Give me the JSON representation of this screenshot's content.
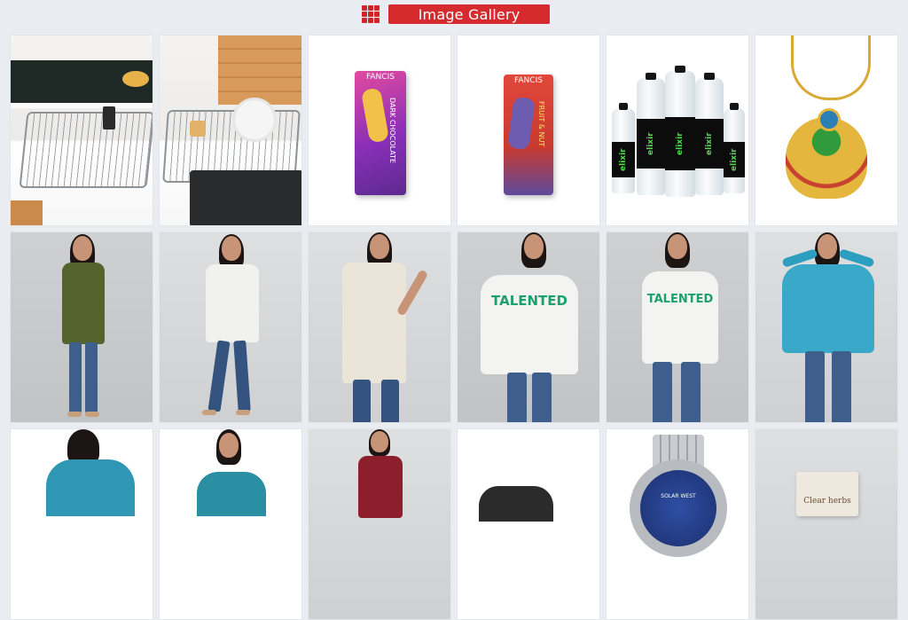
{
  "header": {
    "title": "Image Gallery",
    "icon": "grid-icon",
    "accent": "#d52b2f"
  },
  "gallery": {
    "items": [
      {
        "name": "dish-rack-kitchen-1"
      },
      {
        "name": "dish-rack-kitchen-2"
      },
      {
        "name": "chocolate-bar-dark",
        "brand": "FANCIS",
        "flavor": "DARK CHOCOLATE"
      },
      {
        "name": "chocolate-bar-fruit-nut",
        "brand": "FANCIS",
        "flavor": "FRUIT & NUT"
      },
      {
        "name": "water-bottles",
        "brand": "elixir"
      },
      {
        "name": "peacock-pendant"
      },
      {
        "name": "model-olive-top"
      },
      {
        "name": "model-white-tee"
      },
      {
        "name": "model-cream-tee"
      },
      {
        "name": "model-talented-tee-1",
        "print": "TALENTED"
      },
      {
        "name": "model-talented-tee-2",
        "print": "TALENTED"
      },
      {
        "name": "model-teal-tee"
      },
      {
        "name": "model-teal-back"
      },
      {
        "name": "model-teal-vneck"
      },
      {
        "name": "model-maroon-tee"
      },
      {
        "name": "black-accessory"
      },
      {
        "name": "wrist-watch",
        "brand": "SOLAR WEST"
      },
      {
        "name": "soap-box",
        "brand": "Clear herbs"
      }
    ]
  }
}
